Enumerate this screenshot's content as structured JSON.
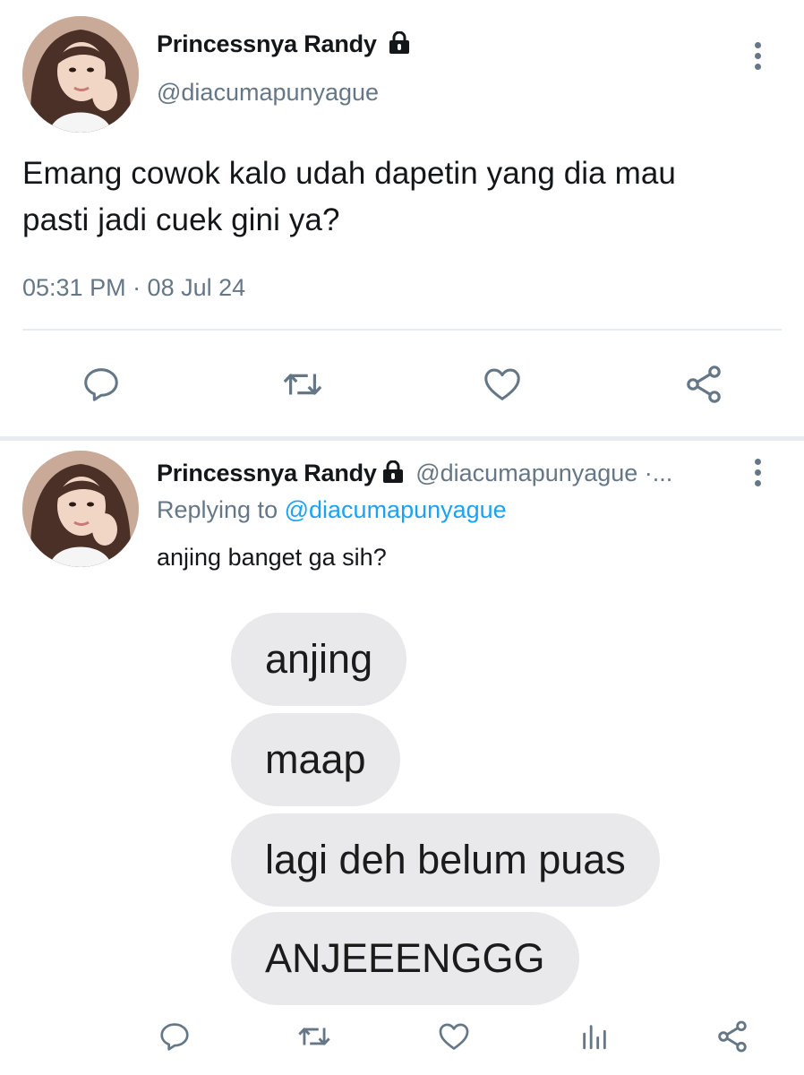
{
  "main_tweet": {
    "display_name": "Princessnya Randy",
    "handle": "@diacumapunyague",
    "text_line1": "Emang cowok kalo udah dapetin yang dia mau",
    "text_line2": "pasti jadi cuek gini ya?",
    "timestamp": "05:31 PM · 08 Jul 24",
    "actions": [
      "reply",
      "retweet",
      "like",
      "share"
    ]
  },
  "reply_tweet": {
    "display_name": "Princessnya Randy",
    "handle": "@diacumapunyague ·...",
    "replying_to_prefix": "Replying to",
    "replying_to_handle": "@diacumapunyague",
    "text": "anjing banget ga sih?",
    "media": {
      "bubbles": [
        "anjing",
        "maap",
        "lagi deh belum puas",
        "ANJEEENGGG"
      ]
    },
    "actions": [
      "reply",
      "retweet",
      "like",
      "views",
      "share"
    ]
  },
  "colors": {
    "text": "#14171a",
    "secondary": "#657786",
    "link": "#1da1f2",
    "divider": "#e6ecf0",
    "bubble": "#e9e9eb"
  }
}
